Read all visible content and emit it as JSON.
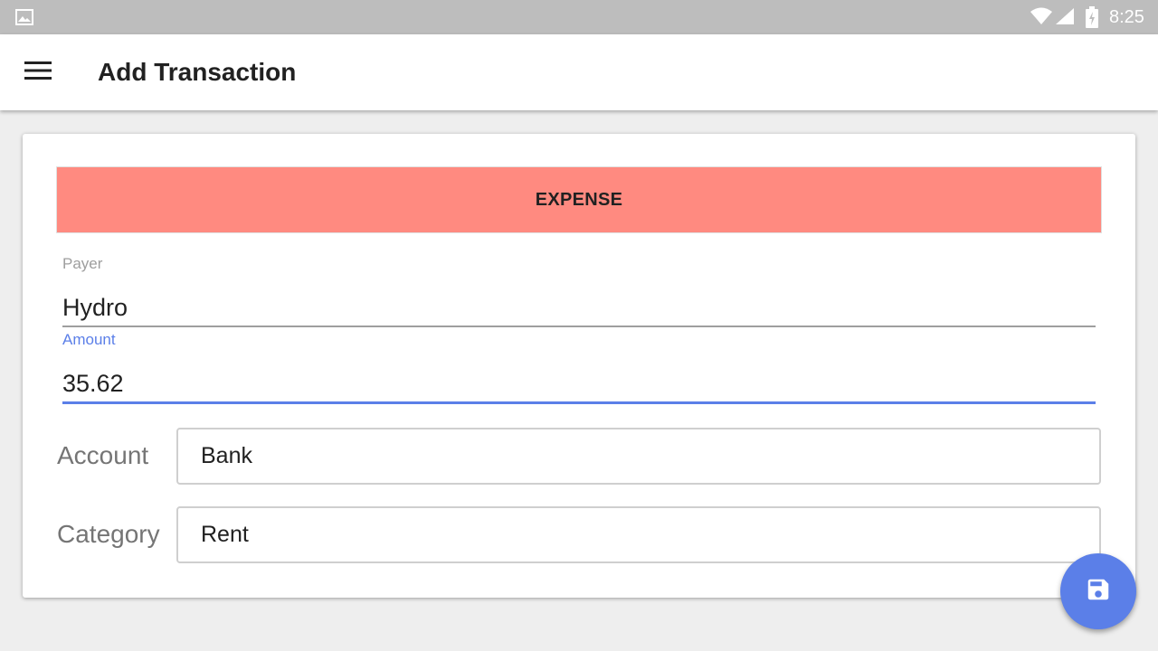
{
  "status_bar": {
    "time": "8:25",
    "icons": [
      "gallery-icon",
      "wifi-icon",
      "signal-icon",
      "battery-charging-icon"
    ]
  },
  "app_bar": {
    "menu_icon": "menu-icon",
    "title": "Add Transaction"
  },
  "form": {
    "type_button_label": "EXPENSE",
    "type_button_color": "#ff8a80",
    "payer": {
      "label": "Payer",
      "value": "Hydro"
    },
    "amount": {
      "label": "Amount",
      "value": "35.62"
    },
    "account": {
      "label": "Account",
      "selected": "Bank"
    },
    "category": {
      "label": "Category",
      "selected": "Rent"
    }
  },
  "fab": {
    "icon": "save-icon",
    "color": "#5b7fe8"
  },
  "colors": {
    "accent": "#5b7fe8",
    "expense": "#ff8a80",
    "status_bar": "#bdbdbd"
  }
}
